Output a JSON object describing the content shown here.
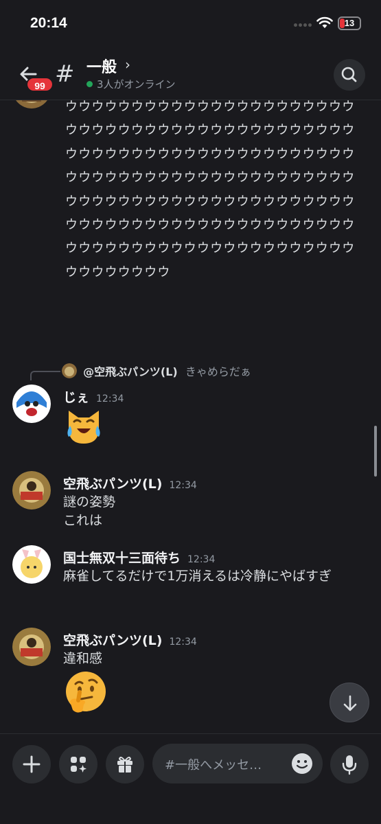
{
  "status_bar": {
    "time": "20:14",
    "battery": "13"
  },
  "header": {
    "unread_badge": "99",
    "hash_symbol": "#",
    "channel_name": "一般",
    "chevron": "›",
    "online_text": "3人がオンライン"
  },
  "messages": {
    "long_text": "ウウウウウウウウウウウウウウウウウウウウウウウウウウウウウウウウウウウウウウウウウウウウウウウウウウウウウウウウウウウウウウウウウウウウウウウウウウウウウウウウウウウウウウウウウウウウウウウウウウウウウウウウウウウウウウウウウウウウウウウウウウウウウウウウウウウウウウウウウウウウウウウウウウウウウウウウウウウウウウウウウウ",
    "reply": {
      "author": "@空飛ぶパンツ(L)",
      "text": "きゃめらだぁ"
    },
    "items": [
      {
        "author": "じぇ",
        "time": "12:34",
        "lines": [],
        "emoji": "😹"
      },
      {
        "author": "空飛ぶパンツ(L)",
        "time": "12:34",
        "lines": [
          "謎の姿勢",
          "これは"
        ],
        "emoji": ""
      },
      {
        "author": "国士無双十三面待ち",
        "time": "12:34",
        "lines": [
          "麻雀してるだけで1万消えるは冷静にやばすぎ"
        ],
        "emoji": ""
      },
      {
        "author": "空飛ぶパンツ(L)",
        "time": "12:34",
        "lines": [
          "違和感"
        ],
        "emoji": "🤔"
      }
    ]
  },
  "composer": {
    "placeholder": "#一般へメッセ…"
  },
  "icons": [
    "back-arrow-icon",
    "search-icon",
    "plus-icon",
    "apps-icon",
    "gift-icon",
    "smiley-icon",
    "microphone-icon",
    "arrow-down-icon",
    "wifi-icon"
  ],
  "colors": {
    "background": "#1a1a1e",
    "badge": "#e5343a",
    "online": "#23a55a",
    "muted": "#949ba4"
  }
}
